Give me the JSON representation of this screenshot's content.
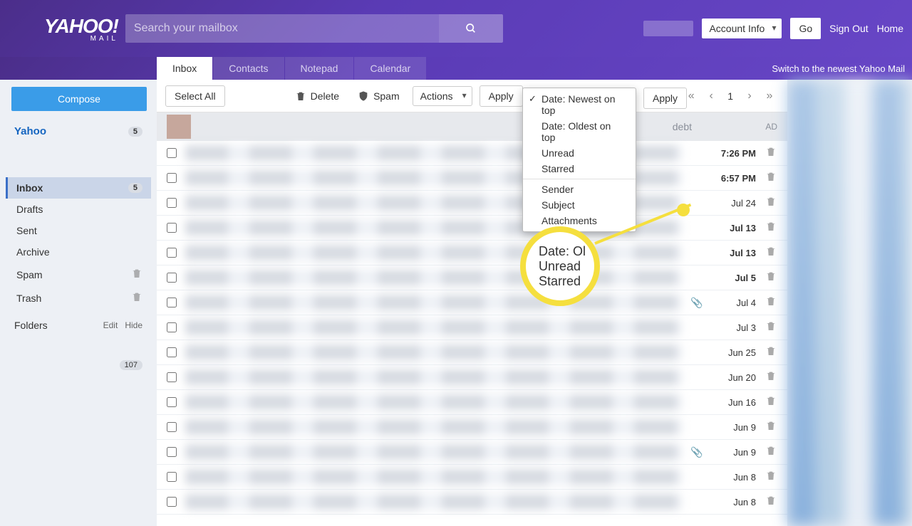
{
  "header": {
    "logo_top": "YAHOO!",
    "logo_bottom": "MAIL",
    "search_placeholder": "Search your mailbox",
    "account_info": "Account Info",
    "go": "Go",
    "sign_out": "Sign Out",
    "home": "Home"
  },
  "tabs": {
    "items": [
      "Inbox",
      "Contacts",
      "Notepad",
      "Calendar"
    ],
    "switch_text": "Switch to the newest Yahoo Mail"
  },
  "sidebar": {
    "compose": "Compose",
    "account_name": "Yahoo",
    "account_badge": "5",
    "items": [
      {
        "label": "Inbox",
        "badge": "5",
        "selected": true
      },
      {
        "label": "Drafts"
      },
      {
        "label": "Sent"
      },
      {
        "label": "Archive"
      },
      {
        "label": "Spam",
        "trash": true
      },
      {
        "label": "Trash",
        "trash": true
      }
    ],
    "folders_label": "Folders",
    "edit": "Edit",
    "hide": "Hide",
    "folder_badge": "107"
  },
  "toolbar": {
    "select_all": "Select All",
    "delete": "Delete",
    "spam": "Spam",
    "actions": "Actions",
    "apply": "Apply",
    "page": "1"
  },
  "sort": {
    "items": [
      "Date: Newest on top",
      "Date: Oldest on top",
      "Unread",
      "Starred",
      "Sender",
      "Subject",
      "Attachments"
    ],
    "checked_index": 0
  },
  "ad": {
    "text": "debt",
    "label": "AD"
  },
  "messages": [
    {
      "date": "7:26 PM",
      "unread": true
    },
    {
      "date": "6:57 PM",
      "unread": true
    },
    {
      "date": "Jul 24"
    },
    {
      "date": "Jul 13",
      "unread": true
    },
    {
      "date": "Jul 13",
      "unread": true
    },
    {
      "date": "Jul 5",
      "unread": true
    },
    {
      "date": "Jul 4",
      "attach": true
    },
    {
      "date": "Jul 3"
    },
    {
      "date": "Jun 25"
    },
    {
      "date": "Jun 20"
    },
    {
      "date": "Jun 16"
    },
    {
      "date": "Jun 9"
    },
    {
      "date": "Jun 9",
      "attach": true
    },
    {
      "date": "Jun 8"
    },
    {
      "date": "Jun 8"
    }
  ],
  "callout": {
    "l1": "Date: Ol",
    "l2": "Unread",
    "l3": "Starred"
  }
}
